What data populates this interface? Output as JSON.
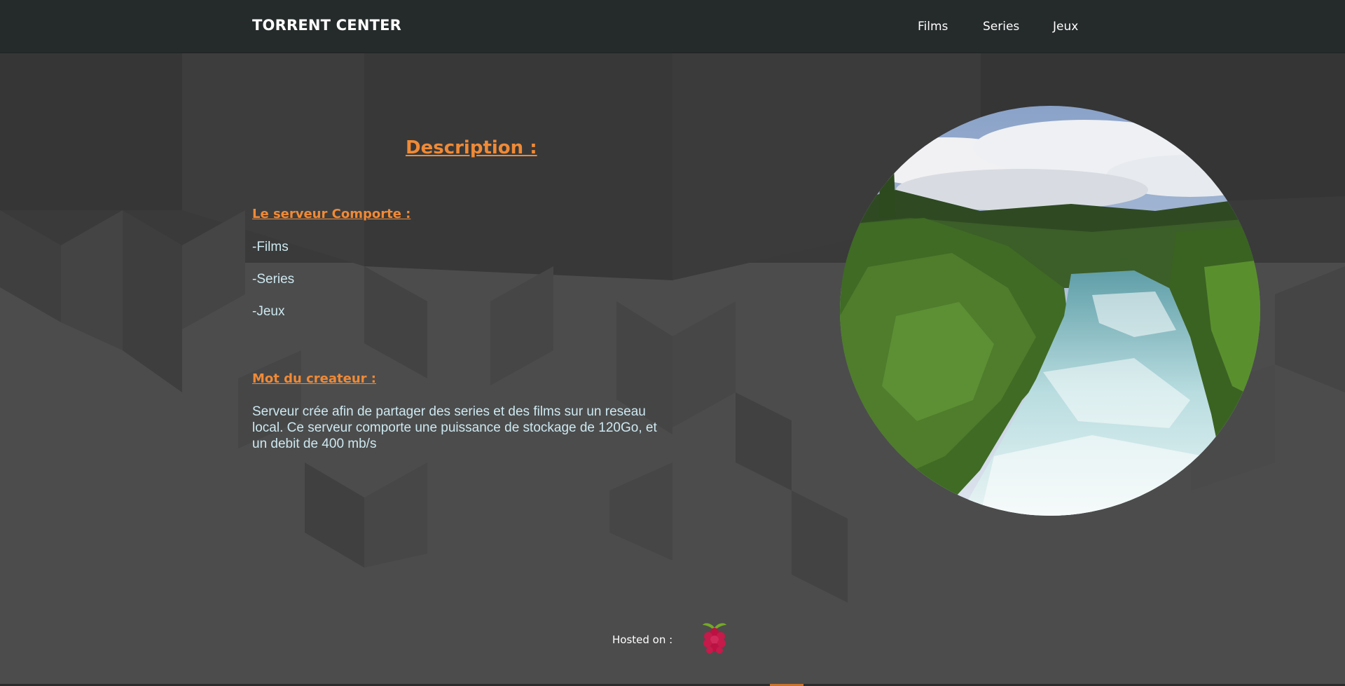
{
  "header": {
    "brand": "TORRENT CENTER",
    "nav": [
      "Films",
      "Series",
      "Jeux"
    ]
  },
  "main": {
    "heading": "Description :",
    "server_section": {
      "title": "Le serveur Comporte :",
      "items": [
        "-Films",
        "-Series",
        "-Jeux"
      ]
    },
    "creator_section": {
      "title": "Mot du createur :",
      "text": "Serveur crée afin de partager des series et des films sur un reseau local. Ce serveur comporte une puissance de stockage de 120Go, et un debit de 400 mb/s"
    },
    "image_icon": "river-rapids-photo"
  },
  "footer": {
    "hosted_label": "Hosted on :",
    "logo_icon": "raspberry-pi-icon"
  },
  "colors": {
    "navbar": "#252a2b",
    "background": "#4a4a4a",
    "accent_orange": "#f08a36",
    "body_text": "#cde8f0"
  }
}
